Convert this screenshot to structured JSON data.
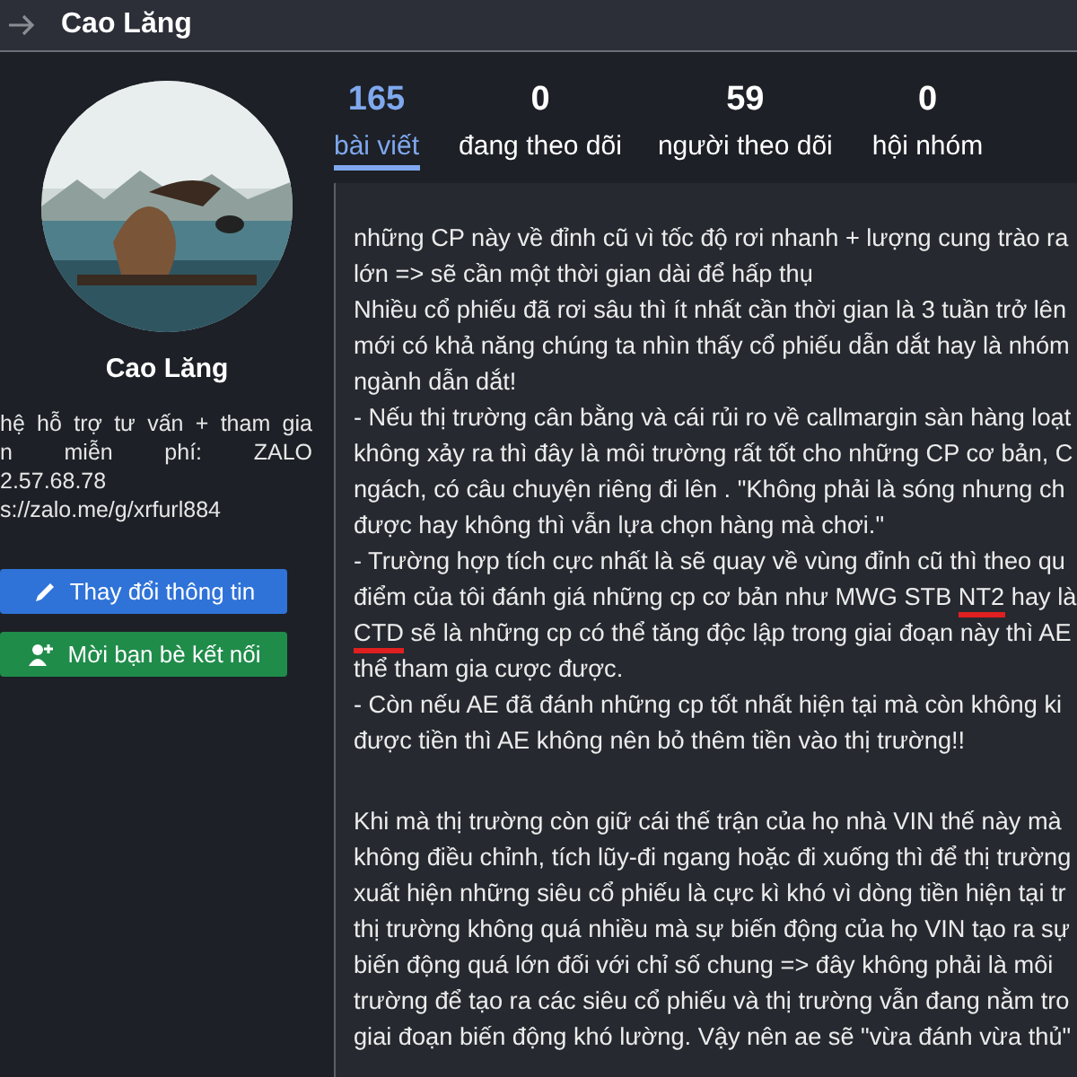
{
  "header": {
    "back_icon": true,
    "title": "Cao Lăng"
  },
  "profile": {
    "name": "Cao Lăng",
    "bio": [
      {
        "text": "hệ hỗ trợ tư vấn + tham gia",
        "kind": "justified"
      },
      {
        "text": "n miễn phí: ZALO",
        "kind": "justified"
      },
      {
        "text": "2.57.68.78",
        "kind": "plain"
      },
      {
        "text": "s://zalo.me/g/xrfurl884",
        "kind": "plain"
      }
    ],
    "buttons": [
      {
        "label": "Thay đổi thông tin",
        "kind": "edit"
      },
      {
        "label": "Mời bạn bè kết nối",
        "kind": "invite"
      }
    ]
  },
  "stats": [
    {
      "count": "165",
      "label": "bài viết",
      "selected": true
    },
    {
      "count": "0",
      "label": "đang theo dõi",
      "selected": false
    },
    {
      "count": "59",
      "label": "người theo dõi",
      "selected": false
    },
    {
      "count": "0",
      "label": "hội nhóm",
      "selected": false
    }
  ],
  "post": {
    "paragraphs": [
      [
        [
          {
            "text": "những CP này về đỉnh cũ vì tốc độ rơi nhanh + lượng cung trào ra",
            "underlined": false
          }
        ],
        [
          {
            "text": "lớn => sẽ cần một thời gian dài để hấp thụ",
            "underlined": false
          }
        ],
        [
          {
            "text": "Nhiều cổ phiếu đã rơi sâu thì ít nhất cần thời gian là 3 tuần trở lên",
            "underlined": false
          }
        ],
        [
          {
            "text": "mới có khả năng chúng ta nhìn thấy cổ phiếu dẫn dắt hay là nhóm",
            "underlined": false
          }
        ],
        [
          {
            "text": "ngành dẫn dắt!",
            "underlined": false
          }
        ],
        [
          {
            "text": "- Nếu thị trường cân bằng và cái rủi ro về callmargin sàn hàng loạt",
            "underlined": false
          }
        ],
        [
          {
            "text": "không xảy ra thì đây là môi trường rất tốt cho những CP cơ bản, C",
            "underlined": false
          }
        ],
        [
          {
            "text": "ngách, có câu chuyện riêng đi lên . \"Không phải là sóng nhưng ch",
            "underlined": false
          }
        ],
        [
          {
            "text": "được hay không thì vẫn lựa chọn hàng mà chơi.\"",
            "underlined": false
          }
        ],
        [
          {
            "text": "- Trường hợp tích cực nhất là sẽ quay về vùng đỉnh cũ thì theo qu",
            "underlined": false
          }
        ],
        [
          {
            "text": "điểm của tôi đánh giá những cp cơ bản như MWG STB ",
            "underlined": false
          },
          {
            "text": "NT2",
            "underlined": true
          },
          {
            "text": " hay là",
            "underlined": false
          }
        ],
        [
          {
            "text": "CTD",
            "underlined": true
          },
          {
            "text": " sẽ là những cp có thể tăng độc lập trong giai đoạn này thì AE",
            "underlined": false
          }
        ],
        [
          {
            "text": "thể tham gia cược được.",
            "underlined": false
          }
        ],
        [
          {
            "text": "- Còn nếu AE đã đánh những cp tốt nhất hiện tại mà còn không ki",
            "underlined": false
          }
        ],
        [
          {
            "text": "được tiền thì AE không nên bỏ thêm tiền vào thị trường!!",
            "underlined": false
          }
        ]
      ],
      [
        [
          {
            "text": "Khi mà thị trường còn giữ cái thế trận của họ nhà VIN thế này mà",
            "underlined": false
          }
        ],
        [
          {
            "text": "không điều chỉnh, tích lũy-đi ngang hoặc đi xuống thì để thị trường",
            "underlined": false
          }
        ],
        [
          {
            "text": "xuất hiện những siêu cổ phiếu là cực kì khó vì dòng tiền hiện tại tr",
            "underlined": false
          }
        ],
        [
          {
            "text": "thị trường không quá nhiều mà sự biến động của họ VIN tạo ra sự",
            "underlined": false
          }
        ],
        [
          {
            "text": "biến động quá lớn đối với chỉ số chung => đây không phải là môi",
            "underlined": false
          }
        ],
        [
          {
            "text": "trường để tạo ra các siêu cổ phiếu và thị trường vẫn đang nằm tro",
            "underlined": false
          }
        ],
        [
          {
            "text": "giai đoạn biến động khó lường. Vậy nên ae sẽ \"vừa đánh vừa thủ\"",
            "underlined": false
          }
        ]
      ]
    ]
  }
}
